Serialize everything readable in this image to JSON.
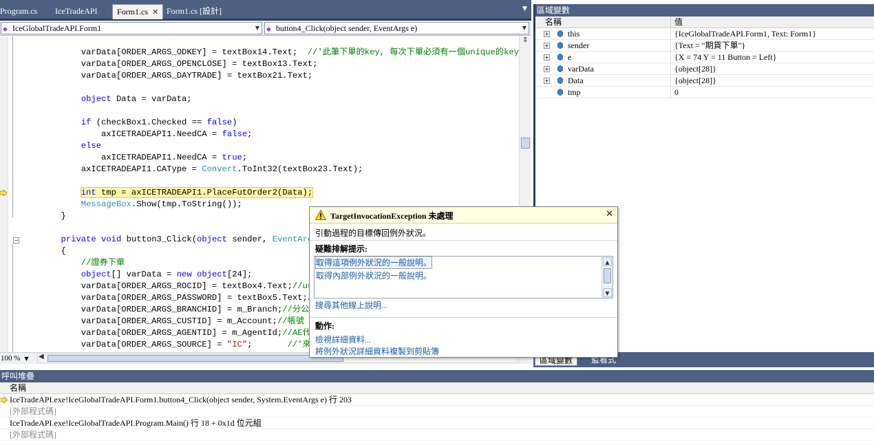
{
  "tabs": [
    {
      "label": "Program.cs",
      "active": false
    },
    {
      "label": "IceTradeAPI",
      "active": false
    },
    {
      "label": "Form1.cs",
      "active": true
    },
    {
      "label": "Form1.cs [設計]",
      "active": false
    }
  ],
  "navbar": {
    "type_combo": "IceGlobalTradeAPI.Form1",
    "member_combo": "button4_Click(object sender, EventArgs e)"
  },
  "code_lines": [
    "            varData[ORDER_ARGS_ODKEY] = textBox14.Text;  //'此筆下單的key, 每次下單必須有一個unique的key",
    "            varData[ORDER_ARGS_OPENCLOSE] = textBox13.Text;",
    "            varData[ORDER_ARGS_DAYTRADE] = textBox21.Text;",
    "",
    "            object Data = varData;",
    "",
    "            if (checkBox1.Checked == false)",
    "                axICETRADEAPI1.NeedCA = false;",
    "            else",
    "                axICETRADEAPI1.NeedCA = true;",
    "            axICETRADEAPI1.CAType = Convert.ToInt32(textBox23.Text);",
    "",
    "            int tmp = axICETRADEAPI1.PlaceFutOrder2(Data);",
    "            MessageBox.Show(tmp.ToString());",
    "        }",
    "",
    "        private void button3_Click(object sender, EventArgs e)",
    "        {",
    "            //證券下單",
    "            object[] varData = new object[24];",
    "            varData[ORDER_ARGS_ROCID] = textBox4.Text;//user",
    "            varData[ORDER_ARGS_PASSWORD] = textBox5.Text;//",
    "            varData[ORDER_ARGS_BRANCHID] = m_Branch;//分公司",
    "            varData[ORDER_ARGS_CUSTID] = m_Account;//帳號",
    "            varData[ORDER_ARGS_AGENTID] = m_AgentId;//AE代號",
    "            varData[ORDER_ARGS_SOURCE] = \"IC\";       //'來源"
  ],
  "editor": {
    "zoom": "100 %"
  },
  "locals": {
    "title": "區域變數",
    "col_name": "名稱",
    "col_value": "值",
    "rows": [
      {
        "name": "this",
        "value": "{IceGlobalTradeAPI.Form1, Text: Form1}",
        "expandable": true
      },
      {
        "name": "sender",
        "value": "{Text = \"期貨下單\"}",
        "expandable": true
      },
      {
        "name": "e",
        "value": "{X = 74 Y = 11 Button = Left}",
        "expandable": true
      },
      {
        "name": "varData",
        "value": "{object[28]}",
        "expandable": true
      },
      {
        "name": "Data",
        "value": "{object[28]}",
        "expandable": true
      },
      {
        "name": "tmp",
        "value": "0",
        "expandable": false
      }
    ],
    "tabs": [
      "區域變數",
      "監看式"
    ]
  },
  "callstack": {
    "title": "呼叫堆疊",
    "col_name": "名稱",
    "rows": [
      {
        "text": "IceTradeAPI.exe!IceGlobalTradeAPI.Form1.button4_Click(object sender, System.EventArgs e) 行 203",
        "current": true,
        "external": false
      },
      {
        "text": "[外部程式碼]",
        "current": false,
        "external": true
      },
      {
        "text": "IceTradeAPI.exe!IceGlobalTradeAPI.Program.Main() 行 18 + 0x1d 位元組",
        "current": false,
        "external": false
      },
      {
        "text": "[外部程式碼]",
        "current": false,
        "external": true
      }
    ]
  },
  "exception": {
    "title": "TargetInvocationException 未處理",
    "message": "引動過程的目標傳回例外狀況。",
    "tips_label": "疑難排解提示:",
    "tips": [
      "取得這項例外狀況的一般說明。",
      "取得內部例外狀況的一般說明。"
    ],
    "search_link": "搜尋其他線上說明...",
    "actions_label": "動作:",
    "actions": [
      "檢視詳細資料...",
      "將例外狀況詳細資料複製到剪貼簿"
    ]
  },
  "colors": {
    "titlebar": "#4d6082",
    "keyword": "#0000ff",
    "type": "#2b91af",
    "comment": "#008000",
    "string": "#a31515",
    "link": "#1a5da8"
  }
}
